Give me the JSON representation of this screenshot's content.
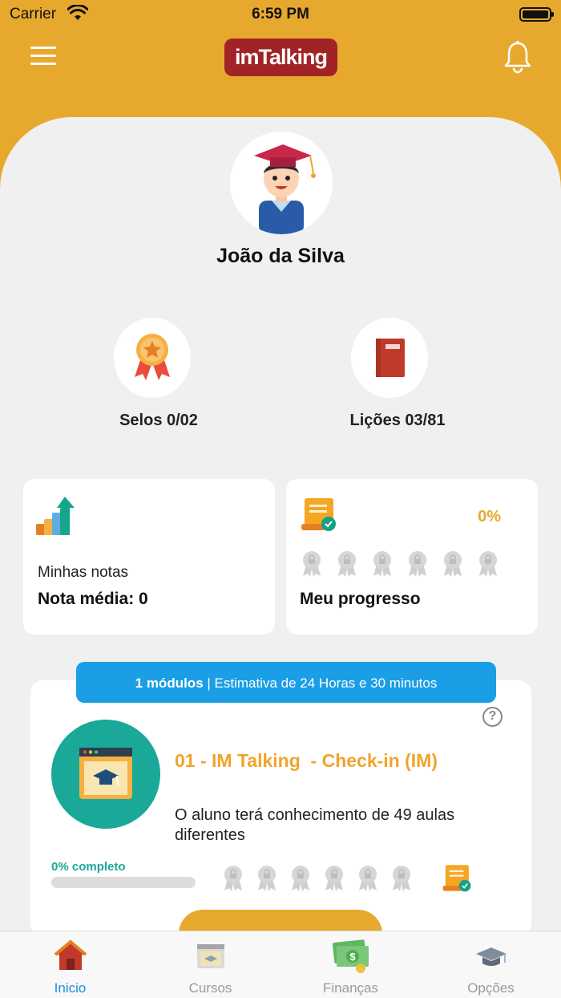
{
  "status_bar": {
    "carrier": "Carrier",
    "time": "6:59 PM"
  },
  "header": {
    "logo_text": "imTalking",
    "menu_icon": "hamburger-icon",
    "notification_icon": "bell-icon"
  },
  "profile": {
    "name": "João da Silva",
    "avatar_icon": "graduate-avatar-icon"
  },
  "stats": {
    "seals": {
      "label": "Selos 0/02",
      "icon": "medal-icon"
    },
    "lessons": {
      "label": "Lições 03/81",
      "icon": "book-icon"
    }
  },
  "notes_card": {
    "icon": "chart-growth-icon",
    "title": "Minhas notas",
    "average": "Nota média: 0"
  },
  "progress_card": {
    "icon": "certificate-icon",
    "percent": "0%",
    "label": "Meu progresso",
    "seal_count": 6
  },
  "module_banner": {
    "count": "1 módulos",
    "separator": " | ",
    "estimate": "Estimativa de 24 Horas e 30 minutos"
  },
  "module": {
    "help_icon": "?",
    "title": "01 - IM Talking  - Check-in (IM)",
    "description": "O aluno terá conhecimento de 49 aulas diferentes",
    "completion": "0% completo",
    "progress": 0
  },
  "tabbar": {
    "items": [
      {
        "label": "Inicio",
        "icon": "home-icon",
        "active": true
      },
      {
        "label": "Cursos",
        "icon": "courses-icon",
        "active": false
      },
      {
        "label": "Finanças",
        "icon": "money-icon",
        "active": false
      },
      {
        "label": "Opções",
        "icon": "graduation-cap-icon",
        "active": false
      }
    ]
  },
  "colors": {
    "accent": "#e7a92d",
    "brand": "#a12326",
    "teal": "#1aa898",
    "blue": "#1a9ee5",
    "title_orange": "#f0a42c"
  }
}
